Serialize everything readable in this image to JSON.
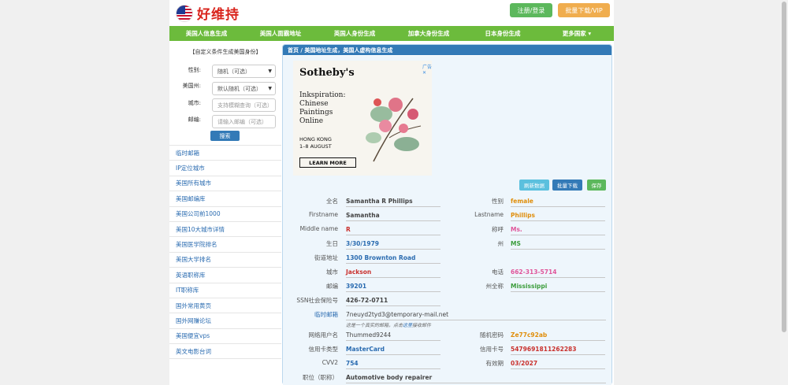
{
  "header": {
    "logo": "好维持",
    "login": "注册/登录",
    "vip": "批量下载/VIP"
  },
  "nav": [
    "美国人信息生成",
    "美国人面霸地址",
    "英国人身份生成",
    "加拿大身份生成",
    "日本身份生成",
    "更多国家 ▾"
  ],
  "filter": {
    "title": "【自定义条件生成美国身份】",
    "gender_label": "性别:",
    "gender_value": "随机（可选）",
    "state_label": "美国州:",
    "state_value": "默认随机（可选）",
    "city_label": "城市:",
    "city_placeholder": "支持模糊查询（可选）",
    "zip_label": "邮编:",
    "zip_placeholder": "请输入邮编（可选）",
    "search": "搜索"
  },
  "links": [
    "临时邮箱",
    "IP定位城市",
    "美国所有城市",
    "美国邮编库",
    "美国公司前1000",
    "美国10大城市详情",
    "美国医学院排名",
    "美国大学排名",
    "英语职称库",
    "IT职称库",
    "国外常用黄页",
    "国外网赚论坛",
    "美国便宜vps",
    "英文电影台词"
  ],
  "breadcrumb": "首页 /  美国地址生成，美国人虚构信息生成",
  "ad": {
    "mark": "广告 ✕",
    "brand": "Sotheby's",
    "text": "Inkspiration: Chinese Paintings Online",
    "place": "HONG KONG",
    "dates": "1–8 AUGUST",
    "btn": "LEARN MORE"
  },
  "actions": {
    "refresh": "刷新数据",
    "batch": "批量下载",
    "save": "保存"
  },
  "fields": {
    "fullname_l": "全名",
    "fullname": "Samantha R Phillips",
    "gender_l": "性别",
    "gender": "female",
    "first_l": "Firstname",
    "first": "Samantha",
    "last_l": "Lastname",
    "last": "Phillips",
    "middle_l": "Middle name",
    "middle": "R",
    "title_l": "称呼",
    "title": "Ms.",
    "dob_l": "生日",
    "dob": "3/30/1979",
    "state_l": "州",
    "state": "MS",
    "street_l": "街道地址",
    "street": "1300 Brownton Road",
    "city_l": "城市",
    "city": "Jackson",
    "phone_l": "电话",
    "phone": "662-313-5714",
    "zip_l": "邮编",
    "zip": "39201",
    "statefull_l": "州全称",
    "statefull": "Mississippi",
    "ssn_l": "SSN社会保险号",
    "ssn": "426-72-0711",
    "email_l": "临时邮箱",
    "email": "7neuyd2tyd3@temporary-mail.net",
    "email_note_a": "这是一个真实的邮箱，点击",
    "email_note_link": "这里",
    "email_note_b": "接收邮件",
    "user_l": "网络用户名",
    "user": "Thummed9244",
    "pwd_l": "随机密码",
    "pwd": "Ze77c92ab",
    "cardtype_l": "信用卡类型",
    "cardtype": "MasterCard",
    "cardno_l": "信用卡号",
    "cardno": "5479691811262283",
    "cvv_l": "CVV2",
    "cvv": "754",
    "exp_l": "有效期",
    "exp": "03/2027",
    "job_l": "职位（职称）",
    "job": "Automotive body repairer"
  }
}
